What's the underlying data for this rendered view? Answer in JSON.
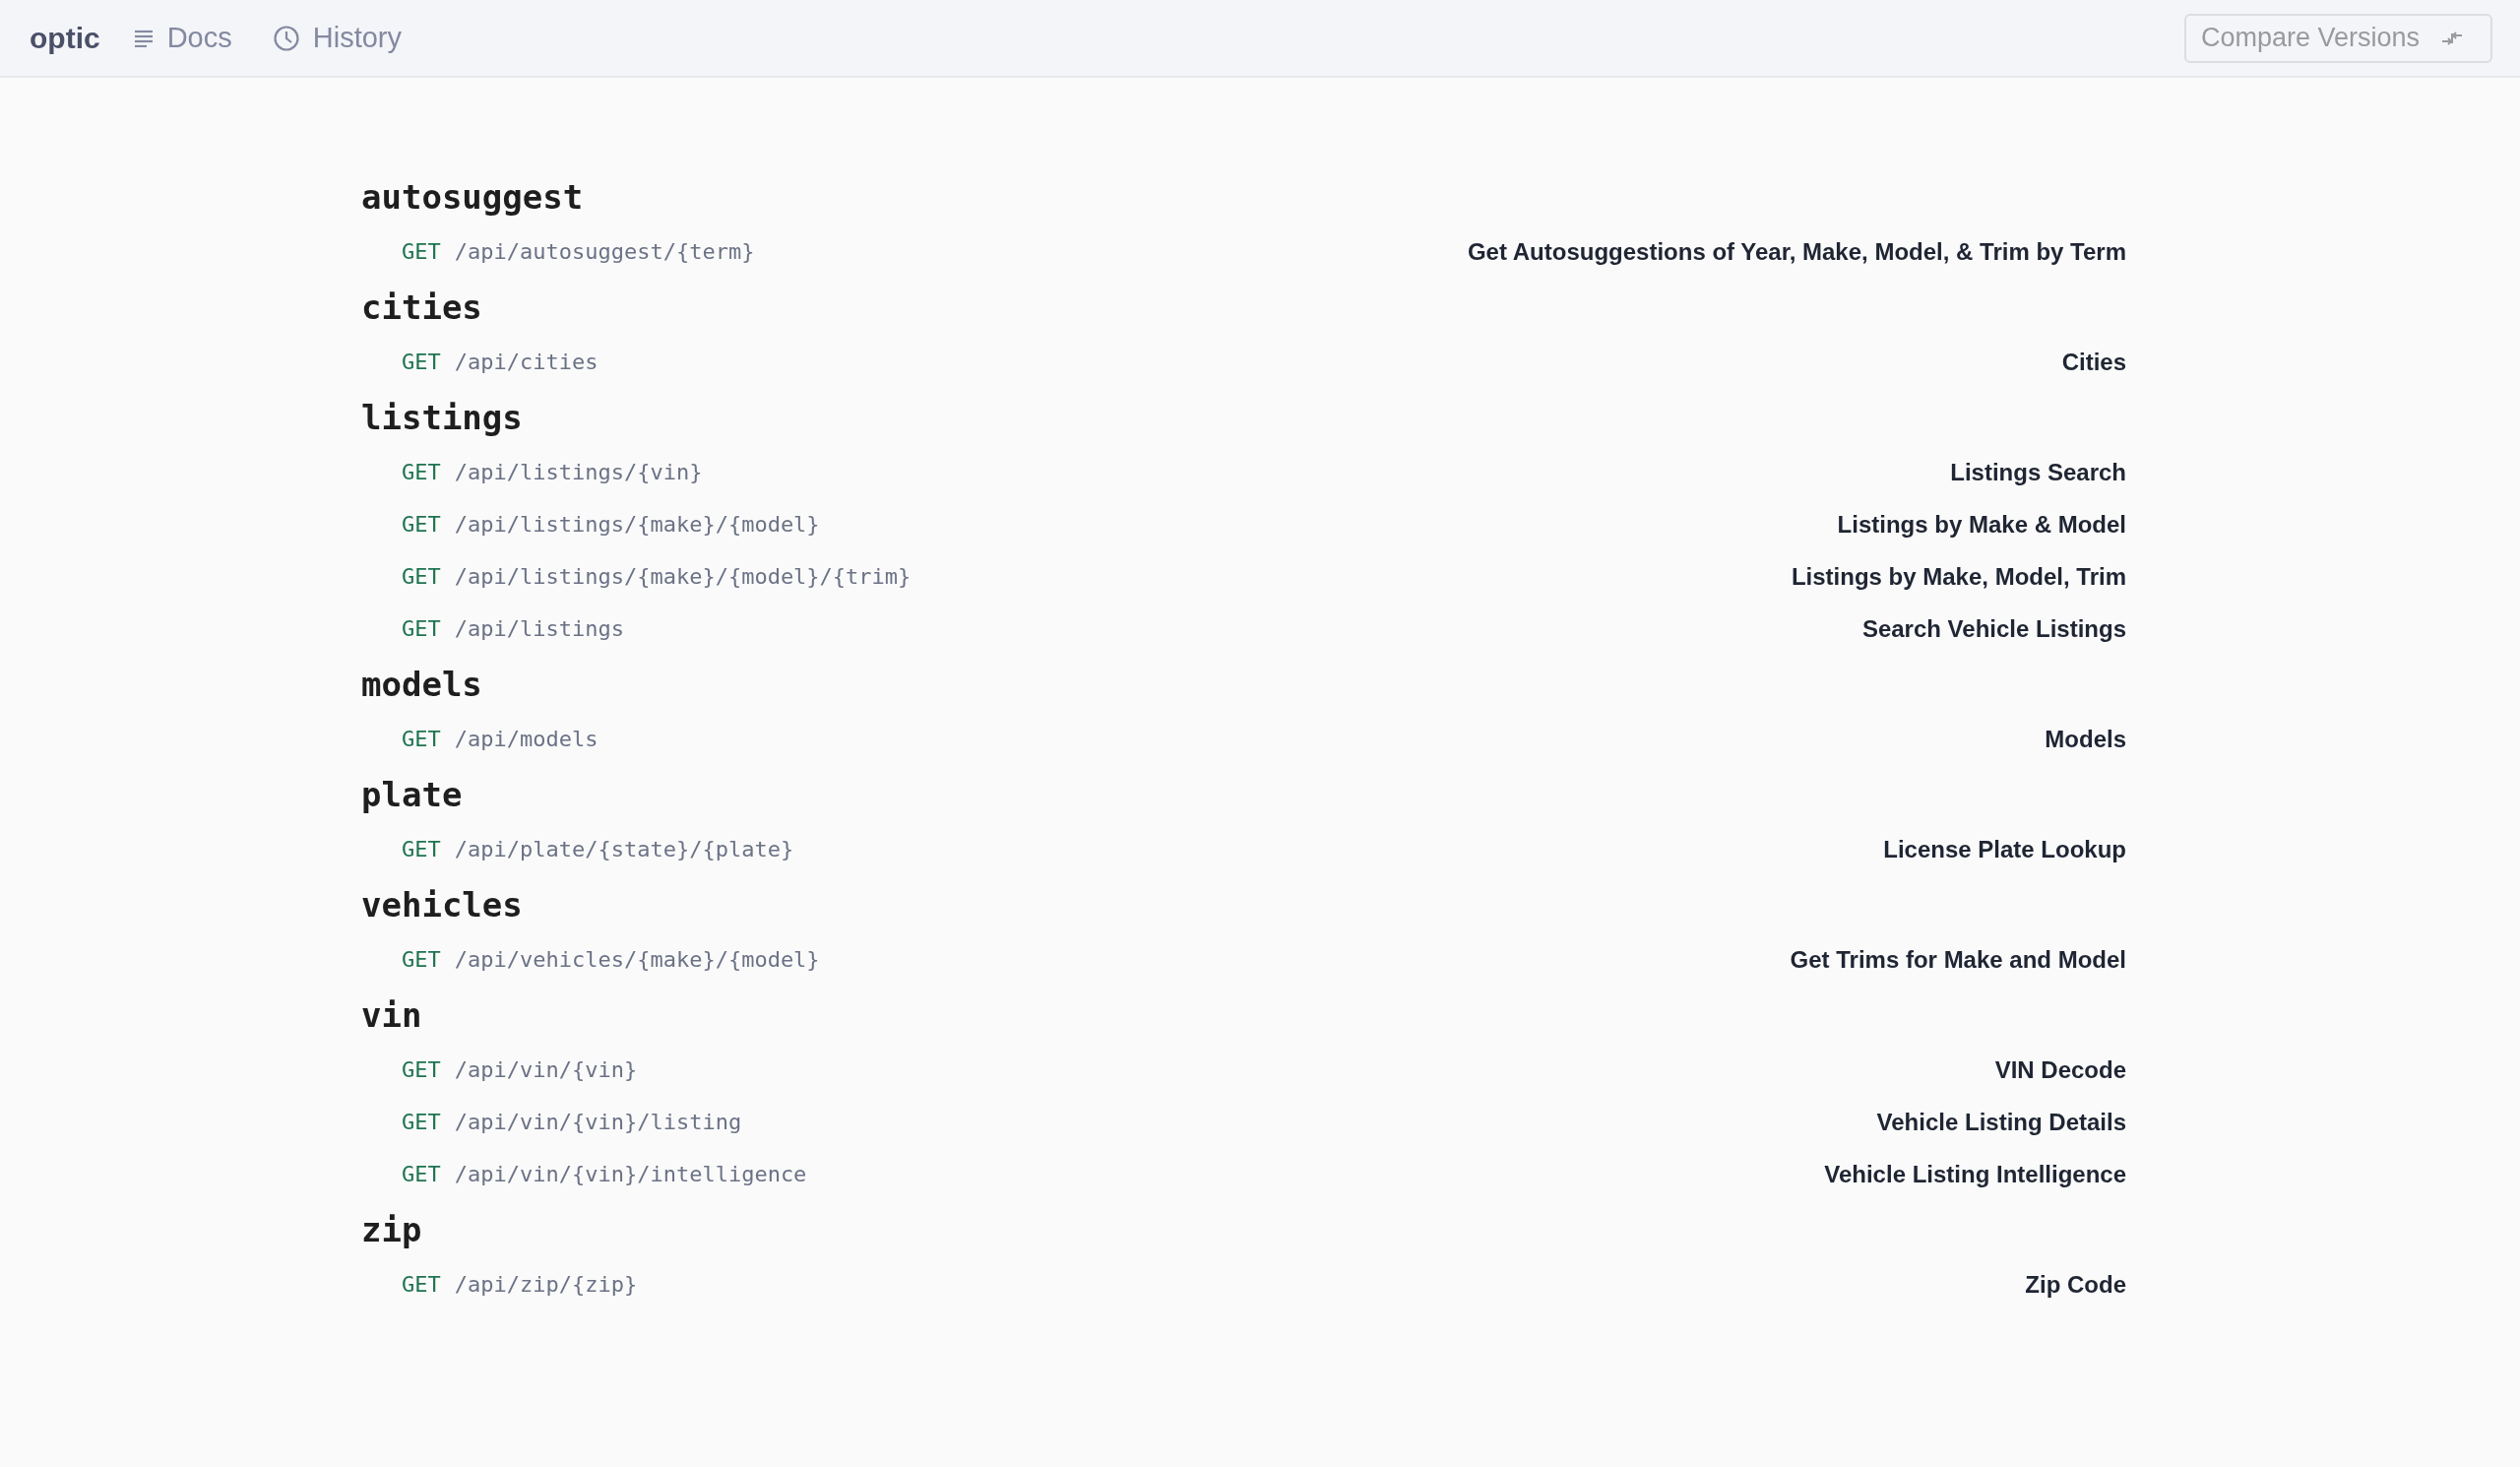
{
  "header": {
    "logo": "optic",
    "nav": [
      {
        "label": "Docs"
      },
      {
        "label": "History"
      }
    ],
    "compare_button": {
      "label": "Compare Versions"
    }
  },
  "groups": [
    {
      "title": "autosuggest",
      "endpoints": [
        {
          "method": "GET",
          "path": "/api/autosuggest/{term}",
          "summary": "Get Autosuggestions of Year, Make, Model, & Trim by Term"
        }
      ]
    },
    {
      "title": "cities",
      "endpoints": [
        {
          "method": "GET",
          "path": "/api/cities",
          "summary": "Cities"
        }
      ]
    },
    {
      "title": "listings",
      "endpoints": [
        {
          "method": "GET",
          "path": "/api/listings/{vin}",
          "summary": "Listings Search"
        },
        {
          "method": "GET",
          "path": "/api/listings/{make}/{model}",
          "summary": "Listings by Make & Model"
        },
        {
          "method": "GET",
          "path": "/api/listings/{make}/{model}/{trim}",
          "summary": "Listings by Make, Model, Trim"
        },
        {
          "method": "GET",
          "path": "/api/listings",
          "summary": "Search Vehicle Listings"
        }
      ]
    },
    {
      "title": "models",
      "endpoints": [
        {
          "method": "GET",
          "path": "/api/models",
          "summary": "Models"
        }
      ]
    },
    {
      "title": "plate",
      "endpoints": [
        {
          "method": "GET",
          "path": "/api/plate/{state}/{plate}",
          "summary": "License Plate Lookup"
        }
      ]
    },
    {
      "title": "vehicles",
      "endpoints": [
        {
          "method": "GET",
          "path": "/api/vehicles/{make}/{model}",
          "summary": "Get Trims for Make and Model"
        }
      ]
    },
    {
      "title": "vin",
      "endpoints": [
        {
          "method": "GET",
          "path": "/api/vin/{vin}",
          "summary": "VIN Decode"
        },
        {
          "method": "GET",
          "path": "/api/vin/{vin}/listing",
          "summary": "Vehicle Listing Details"
        },
        {
          "method": "GET",
          "path": "/api/vin/{vin}/intelligence",
          "summary": "Vehicle Listing Intelligence"
        }
      ]
    },
    {
      "title": "zip",
      "endpoints": [
        {
          "method": "GET",
          "path": "/api/zip/{zip}",
          "summary": "Zip Code"
        }
      ]
    }
  ]
}
